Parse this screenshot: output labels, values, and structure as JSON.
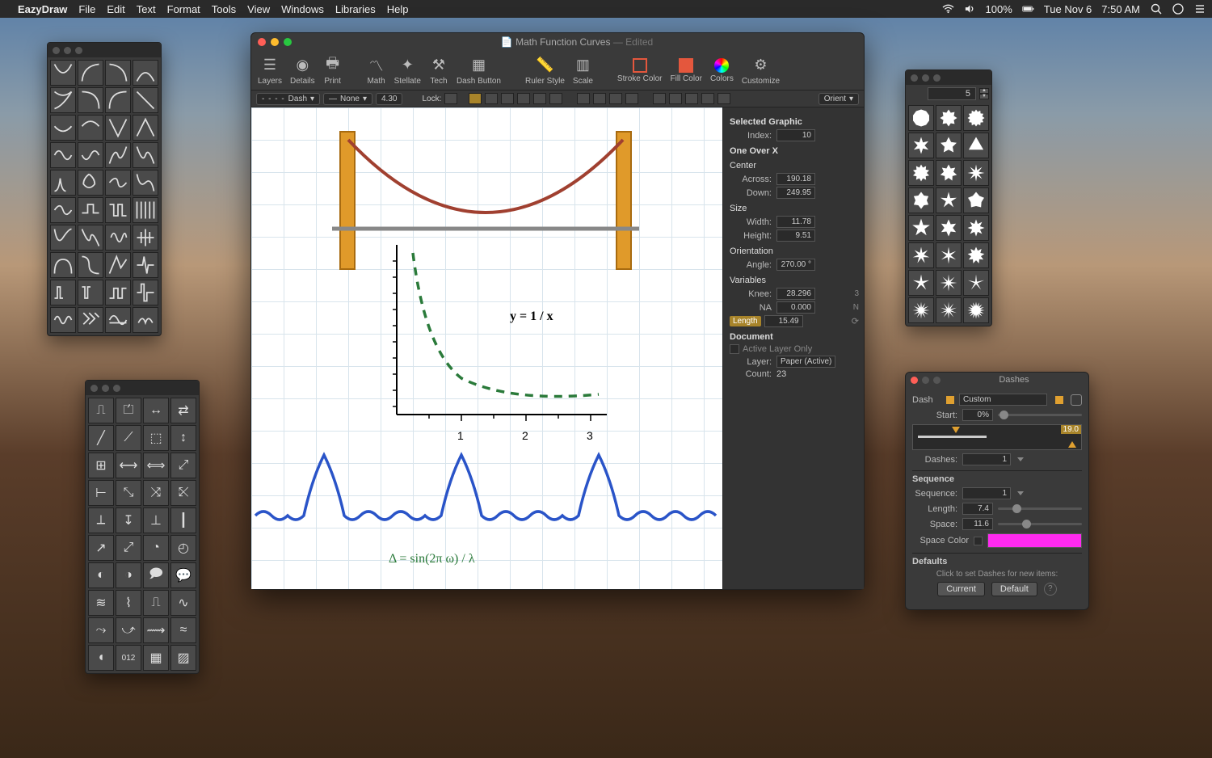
{
  "menubar": {
    "app": "EazyDraw",
    "items": [
      "File",
      "Edit",
      "Text",
      "Format",
      "Tools",
      "View",
      "Windows",
      "Libraries",
      "Help"
    ],
    "battery": "100%",
    "date": "Tue Nov 6",
    "time": "7:50 AM"
  },
  "document": {
    "title": "Math  Function Curves",
    "edited": "— Edited",
    "toolbar": [
      "Layers",
      "Details",
      "Print",
      "Math",
      "Stellate",
      "Tech",
      "Dash Button",
      "Ruler Style",
      "Scale",
      "Stroke Color",
      "Fill Color",
      "Colors",
      "Customize"
    ],
    "optionbar": {
      "dash": "Dash",
      "none": "None",
      "num": "4.30",
      "lock": "Lock:",
      "orient": "Orient"
    },
    "eq1": "y = 1 / x",
    "eq2": "Δ = sin(2π ω) / λ",
    "axis_ticks": [
      "1",
      "2",
      "3"
    ]
  },
  "inspector": {
    "selected": "Selected Graphic",
    "index_lbl": "Index:",
    "index": "10",
    "oneover": "One Over X",
    "center": "Center",
    "across_lbl": "Across:",
    "across": "190.18",
    "down_lbl": "Down:",
    "down": "249.95",
    "size": "Size",
    "width_lbl": "Width:",
    "width": "11.78",
    "height_lbl": "Height:",
    "height": "9.51",
    "orientation": "Orientation",
    "angle_lbl": "Angle:",
    "angle": "270.00 °",
    "variables": "Variables",
    "knee_lbl": "Knee:",
    "knee": "28.296",
    "na_lbl": "NA",
    "na": "0.000",
    "var_3": "3",
    "var_n": "N",
    "length_tag": "Length",
    "length": "15.49",
    "doc": "Document",
    "active": "Active Layer Only",
    "layer_lbl": "Layer:",
    "layer": "Paper (Active)",
    "count_lbl": "Count:",
    "count": "23"
  },
  "stars": {
    "num": "5"
  },
  "dashes": {
    "title": "Dashes",
    "dash_lbl": "Dash",
    "dash_val": "Custom",
    "start_lbl": "Start:",
    "start": "0%",
    "hilite": "19.0",
    "dashes_lbl": "Dashes:",
    "dashes_val": "1",
    "sequence": "Sequence",
    "seq_lbl": "Sequence:",
    "seq_val": "1",
    "length_lbl": "Length:",
    "length": "7.4",
    "space_lbl": "Space:",
    "space": "11.6",
    "spacecolor": "Space Color",
    "defaults": "Defaults",
    "hint": "Click to set Dashes for new items:",
    "btn_current": "Current",
    "btn_default": "Default"
  },
  "tool_label_012": "012"
}
